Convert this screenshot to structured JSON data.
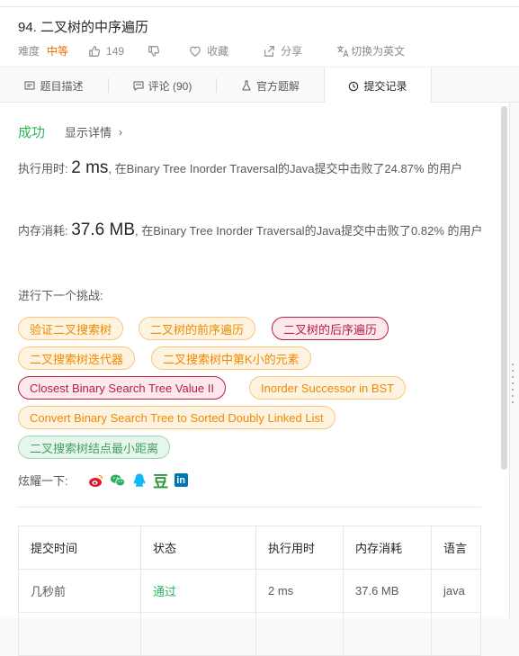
{
  "problem": {
    "title": "94. 二叉树的中序遍历",
    "difficulty_label": "难度",
    "difficulty": "中等",
    "likes": "149",
    "favorite_label": "收藏",
    "share_label": "分享",
    "switch_lang_label": "切换为英文"
  },
  "tabs": [
    {
      "label": "题目描述",
      "icon": "description-icon"
    },
    {
      "label": "评论 (90)",
      "icon": "comment-icon"
    },
    {
      "label": "官方题解",
      "icon": "solution-icon"
    },
    {
      "label": "提交记录",
      "icon": "history-icon",
      "active": true
    }
  ],
  "result": {
    "status": "成功",
    "detail_label": "显示详情",
    "runtime_prefix": "执行用时: ",
    "runtime_value": "2 ms",
    "runtime_suffix": ", 在Binary Tree Inorder Traversal的Java提交中击败了24.87% 的用户",
    "memory_prefix": "内存消耗: ",
    "memory_value": "37.6 MB",
    "memory_suffix": ", 在Binary Tree Inorder Traversal的Java提交中击败了0.82% 的用户"
  },
  "challenge": {
    "label": "进行下一个挑战:",
    "tags": [
      {
        "label": "验证二叉搜索树",
        "level": "medium"
      },
      {
        "label": "二叉树的前序遍历",
        "level": "medium"
      },
      {
        "label": "二叉树的后序遍历",
        "level": "hard"
      },
      {
        "label": "二叉搜索树迭代器",
        "level": "medium"
      },
      {
        "label": "二叉搜索树中第K小的元素",
        "level": "medium"
      },
      {
        "label": "Closest Binary Search Tree Value II",
        "level": "hard"
      },
      {
        "label": "Inorder Successor in BST",
        "level": "medium"
      },
      {
        "label": "Convert Binary Search Tree to Sorted Doubly Linked List",
        "level": "medium"
      },
      {
        "label": "二叉搜索树结点最小距离",
        "level": "easy"
      }
    ]
  },
  "share": {
    "label": "炫耀一下:",
    "icons": [
      "weibo-icon",
      "wechat-icon",
      "qq-icon",
      "douban-icon",
      "linkedin-icon"
    ],
    "douban_glyph": "豆",
    "linkedin_glyph": "in"
  },
  "submissions": {
    "headers": [
      "提交时间",
      "状态",
      "执行用时",
      "内存消耗",
      "语言"
    ],
    "rows": [
      [
        "几秒前",
        "通过",
        "2 ms",
        "37.6 MB",
        "java"
      ]
    ]
  },
  "colors": {
    "success": "#2db55d",
    "medium": "#ef8a00",
    "hard": "#b51f48",
    "easy": "#43a05f"
  }
}
